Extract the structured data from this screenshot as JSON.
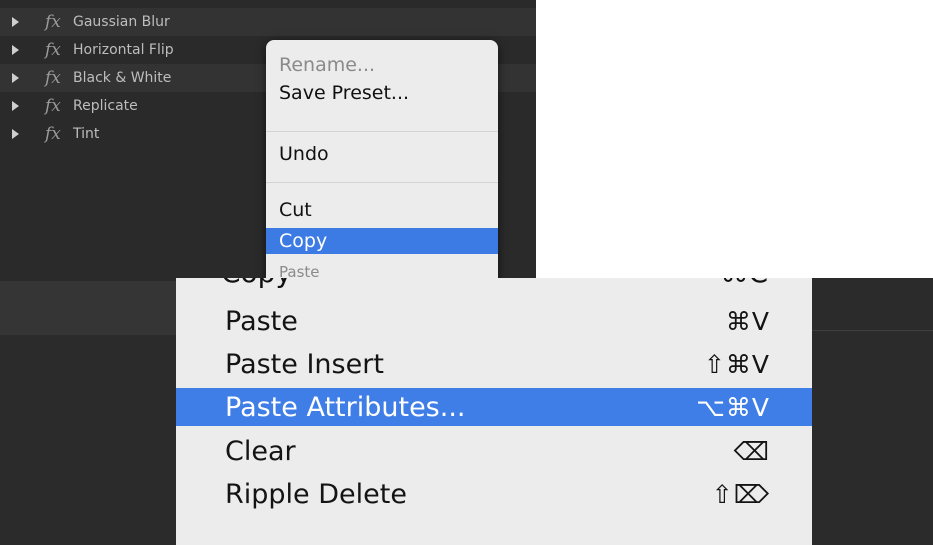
{
  "effects_panel": {
    "fx_glyph": "fx",
    "items": [
      {
        "label": "Gaussian Blur"
      },
      {
        "label": "Horizontal Flip"
      },
      {
        "label": "Black & White"
      },
      {
        "label": "Replicate"
      },
      {
        "label": "Tint"
      }
    ]
  },
  "small_menu": {
    "rename": "Rename...",
    "save_preset": "Save Preset...",
    "undo": "Undo",
    "cut": "Cut",
    "copy": "Copy",
    "paste": "Paste"
  },
  "big_menu": {
    "partial_label": "Copy",
    "partial_shortcut": "⌘C",
    "items": [
      {
        "label": "Paste",
        "shortcut": "⌘V"
      },
      {
        "label": "Paste Insert",
        "shortcut": "⇧⌘V"
      },
      {
        "label": "Paste Attributes...",
        "shortcut": "⌥⌘V"
      },
      {
        "label": "Clear",
        "shortcut": "⌫"
      },
      {
        "label": "Ripple Delete",
        "shortcut": "⇧⌦"
      }
    ]
  },
  "colors": {
    "panel_bg": "#2a2a2a",
    "menu_bg": "#ececec",
    "highlight": "#3d7be4"
  }
}
